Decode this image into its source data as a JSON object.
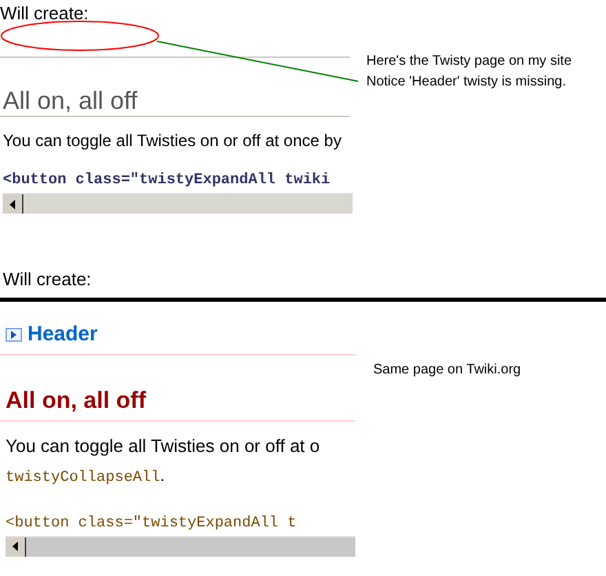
{
  "top_panel": {
    "caption": "Will create:",
    "heading": "All on, all off",
    "paragraph": "You can toggle all Twisties on or off at once by",
    "code": "<button class=\"twistyExpandAll twiki"
  },
  "top_annotation": {
    "lines": [
      "Here's the Twisty page on my site",
      "Notice 'Header' twisty is missing."
    ]
  },
  "bottom_panel": {
    "caption": "Will create:",
    "twisty": {
      "label": "Header",
      "expanded": false
    },
    "heading": "All on, all off",
    "paragraph": "You can toggle all Twisties on or off at o",
    "inline_code": "twistyCollapseAll",
    "inline_tail": ".",
    "code": "<button class=\"twistyExpandAll t"
  },
  "bottom_annotation": "Same page on Twiki.org"
}
